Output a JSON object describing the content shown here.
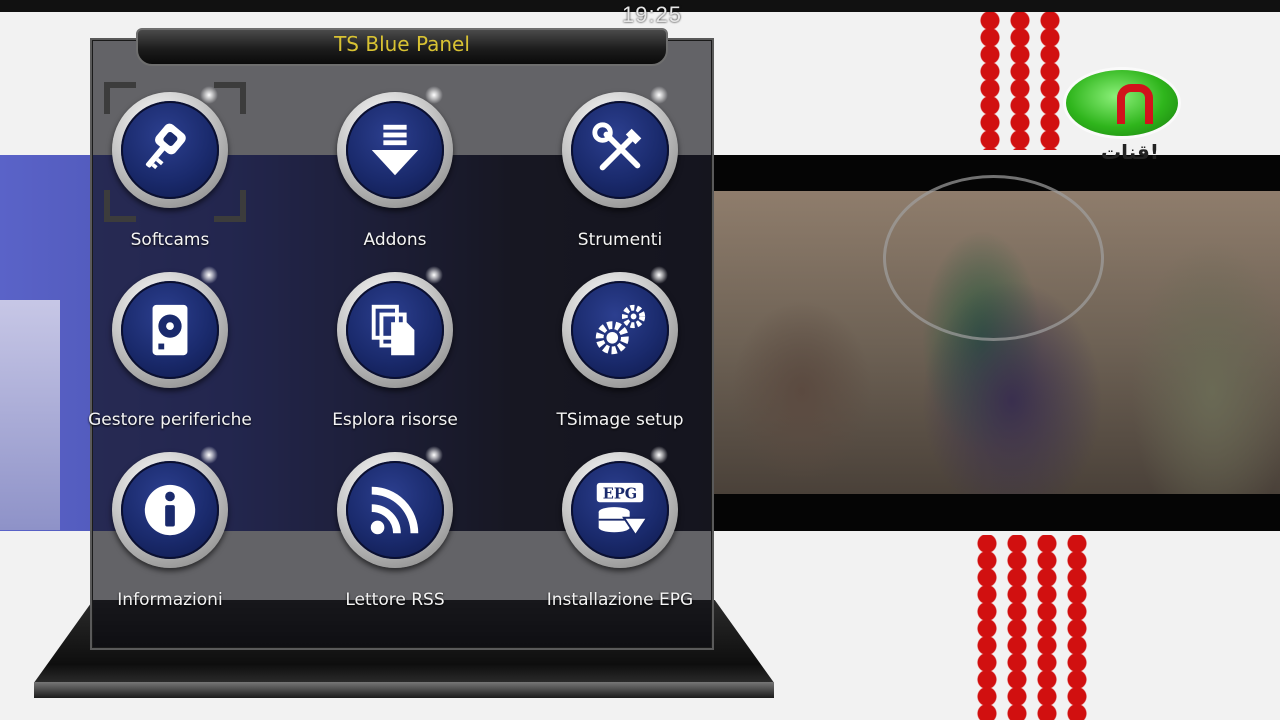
{
  "clock": "19:25",
  "panel": {
    "title": "TS Blue Panel",
    "title_color": "#d8c233",
    "selected_index": 0
  },
  "channel_logo": {
    "text": "قنات!"
  },
  "items": [
    {
      "label": "Softcams",
      "icon": "key-icon"
    },
    {
      "label": "Addons",
      "icon": "download-arrow-icon"
    },
    {
      "label": "Strumenti",
      "icon": "tools-icon"
    },
    {
      "label": "Gestore periferiche",
      "icon": "hard-drive-icon"
    },
    {
      "label": "Esplora risorse",
      "icon": "files-icon"
    },
    {
      "label": "TSimage setup",
      "icon": "gears-icon"
    },
    {
      "label": "Informazioni",
      "icon": "info-icon"
    },
    {
      "label": "Lettore RSS",
      "icon": "rss-icon"
    },
    {
      "label": "Installazione EPG",
      "icon": "epg-icon",
      "badge": "EPG"
    }
  ]
}
